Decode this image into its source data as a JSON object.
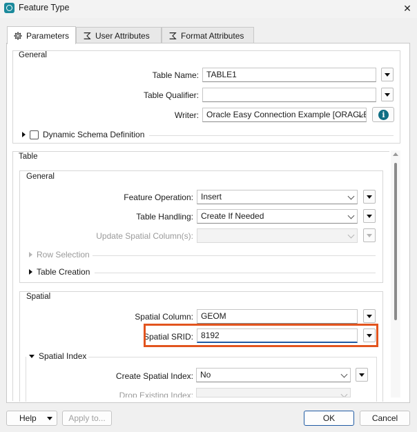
{
  "window": {
    "title": "Feature Type",
    "close": "✕"
  },
  "tabs": [
    {
      "label": "Parameters",
      "icon": "gear-icon",
      "active": true
    },
    {
      "label": "User Attributes",
      "icon": "sigma-icon",
      "active": false
    },
    {
      "label": "Format Attributes",
      "icon": "sigma-icon",
      "active": false
    }
  ],
  "general": {
    "title": "General",
    "table_name_label": "Table Name:",
    "table_name_value": "TABLE1",
    "table_qualifier_label": "Table Qualifier:",
    "table_qualifier_value": "",
    "writer_label": "Writer:",
    "writer_value": "Oracle Easy Connection Example [ORACLE]",
    "dynamic_schema_label": "Dynamic Schema Definition"
  },
  "table": {
    "title": "Table",
    "general": {
      "title": "General",
      "feature_operation_label": "Feature Operation:",
      "feature_operation_value": "Insert",
      "table_handling_label": "Table Handling:",
      "table_handling_value": "Create If Needed",
      "update_spatial_label": "Update Spatial Column(s):",
      "update_spatial_value": "",
      "row_selection_label": "Row Selection",
      "table_creation_label": "Table Creation"
    },
    "spatial": {
      "title": "Spatial",
      "spatial_column_label": "Spatial Column:",
      "spatial_column_value": "GEOM",
      "spatial_srid_label": "Spatial SRID:",
      "spatial_srid_value": "8192",
      "spatial_index_label": "Spatial Index",
      "create_index_label": "Create Spatial Index:",
      "create_index_value": "No",
      "drop_index_label": "Drop Existing Index:",
      "drop_index_value": ""
    }
  },
  "footer": {
    "help_label": "Help",
    "apply_label": "Apply to...",
    "ok_label": "OK",
    "cancel_label": "Cancel"
  },
  "colors": {
    "highlight": "#e2541e",
    "accent": "#1f5aa3",
    "app_icon": "#1b8a9c"
  }
}
